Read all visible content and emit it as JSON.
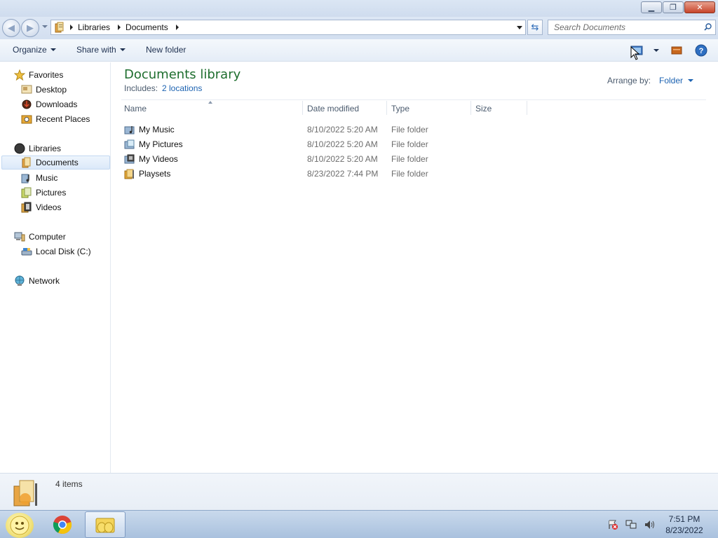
{
  "window": {
    "caption_buttons": {
      "minimize": "minimize",
      "restore": "restore",
      "close": "close"
    }
  },
  "address": {
    "breadcrumb": [
      "Libraries",
      "Documents"
    ],
    "search_placeholder": "Search Documents"
  },
  "toolbar": {
    "organize_label": "Organize",
    "share_label": "Share with",
    "new_folder_label": "New folder",
    "icons": [
      "view-options-icon",
      "preview-pane-icon",
      "help-icon"
    ]
  },
  "nav": {
    "favorites": {
      "label": "Favorites",
      "items": [
        "Desktop",
        "Downloads",
        "Recent Places"
      ]
    },
    "libraries": {
      "label": "Libraries",
      "items": [
        "Documents",
        "Music",
        "Pictures",
        "Videos"
      ],
      "selected": "Documents"
    },
    "computer": {
      "label": "Computer",
      "items": [
        "Local Disk (C:)"
      ]
    },
    "network": {
      "label": "Network"
    }
  },
  "content": {
    "title": "Documents library",
    "includes_label": "Includes:",
    "includes_link": "2 locations",
    "arrange_label": "Arrange by:",
    "arrange_value": "Folder",
    "columns": [
      "Name",
      "Date modified",
      "Type",
      "Size"
    ],
    "files": [
      {
        "name": "My Music",
        "date": "8/10/2022 5:20 AM",
        "type": "File folder",
        "size": ""
      },
      {
        "name": "My Pictures",
        "date": "8/10/2022 5:20 AM",
        "type": "File folder",
        "size": ""
      },
      {
        "name": "My Videos",
        "date": "8/10/2022 5:20 AM",
        "type": "File folder",
        "size": ""
      },
      {
        "name": "Playsets",
        "date": "8/23/2022 7:44 PM",
        "type": "File folder",
        "size": ""
      }
    ]
  },
  "details": {
    "item_count": "4 items"
  },
  "taskbar": {
    "apps": [
      "chrome-icon",
      "file-explorer-icon"
    ],
    "time": "7:51 PM",
    "date": "8/23/2022"
  },
  "colors": {
    "accent_green": "#1e6e2e",
    "link_blue": "#1b62b1"
  }
}
